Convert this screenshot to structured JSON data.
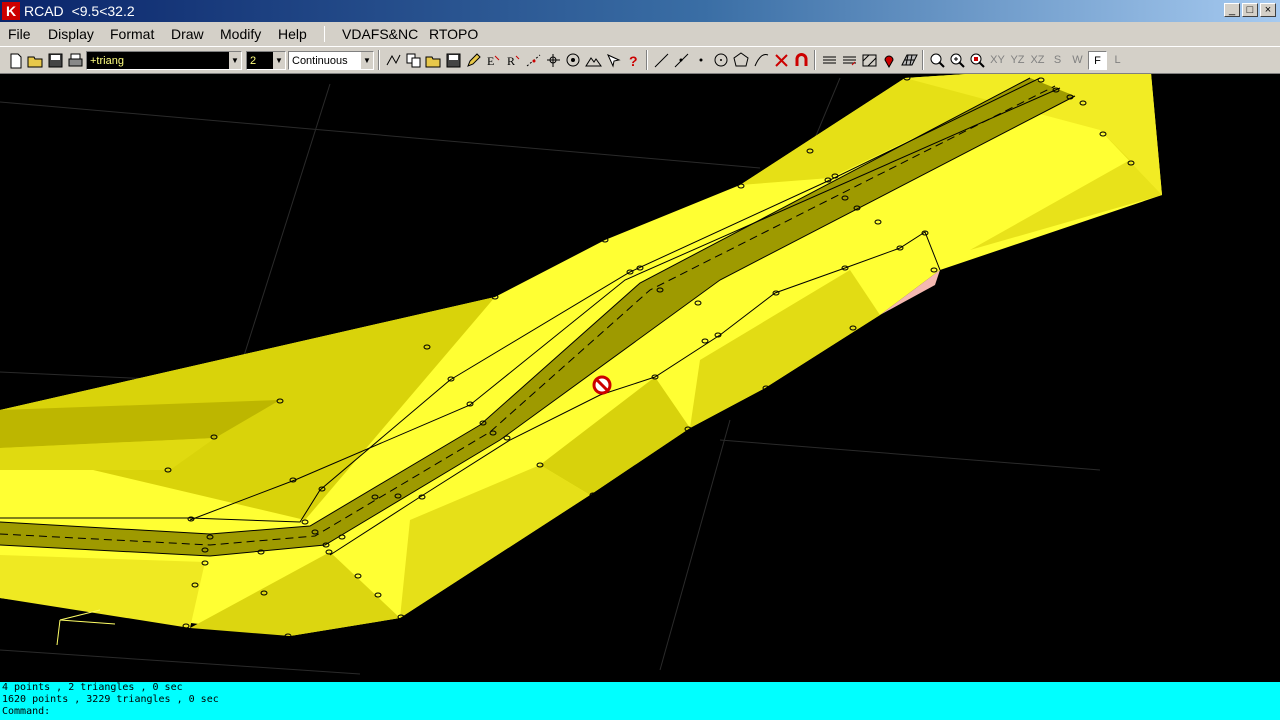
{
  "window": {
    "app_name": "RCAD",
    "coords": "<9.5<32.2",
    "controls": [
      "_",
      "□",
      "×"
    ]
  },
  "menu": [
    "File",
    "Display",
    "Format",
    "Draw",
    "Modify",
    "Help",
    "VDAFS&NC",
    "RTOPO"
  ],
  "toolbar": {
    "layer": "+triang",
    "color": "2",
    "linetype": "Continuous",
    "view_buttons": [
      "XY",
      "YZ",
      "XZ",
      "S",
      "W",
      "F",
      "L"
    ]
  },
  "colors": {
    "surface": "#ffff33",
    "surface_dark": "#c9c200",
    "road": "#9e9a00",
    "background": "#000000",
    "command_bg": "#00ffff",
    "highlight": "#f4b8b0"
  },
  "command": {
    "lines": [
      "4 points , 2 triangles , 0 sec",
      "1620 points , 3229 triangles , 0 sec",
      "Command:"
    ]
  }
}
